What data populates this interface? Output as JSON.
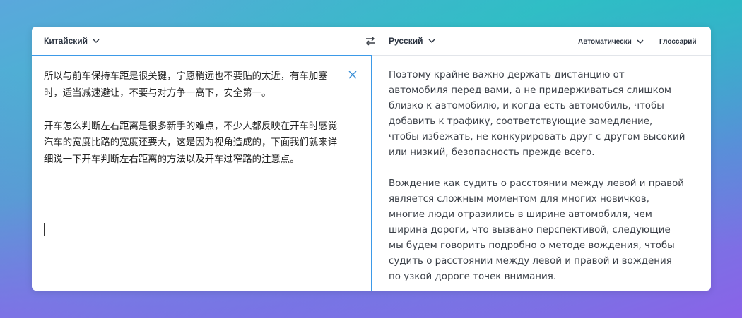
{
  "header": {
    "source_language": "Китайский",
    "target_language": "Русский",
    "auto_label": "Автоматически",
    "glossary_label": "Глоссарий",
    "swap_icon": "swap-arrows-icon"
  },
  "source": {
    "text": "所以与前车保持车距是很关键，宁愿稍远也不要贴的太近，有车加塞时，适当减速避让，不要与对方争一高下，安全第一。\n\n开车怎么判断左右距离是很多新手的难点，不少人都反映在开车时感觉汽车的宽度比路的宽度还要大，这是因为视角造成的，下面我们就来详细说一下开车判断左右距离的方法以及开车过窄路的注意点。"
  },
  "target": {
    "text": "Поэтому крайне важно держать дистанцию от автомобиля перед вами, а не придерживаться слишком близко к автомобилю, и когда есть автомобиль, чтобы добавить к трафику, соответствующие замедление, чтобы избежать, не конкурировать друг с другом высокий или низкий, безопасность прежде всего.\n\nВождение как судить о расстоянии между левой и правой является сложным моментом для многих новичков, многие люди отразились в ширине автомобиля, чем ширина дороги, что вызвано перспективой, следующие мы будем говорить подробно о методе вождения, чтобы судить о расстоянии между левой и правой и вождения по узкой дороге точек внимания."
  },
  "colors": {
    "accent": "#3d9ae8",
    "text": "#222222"
  }
}
